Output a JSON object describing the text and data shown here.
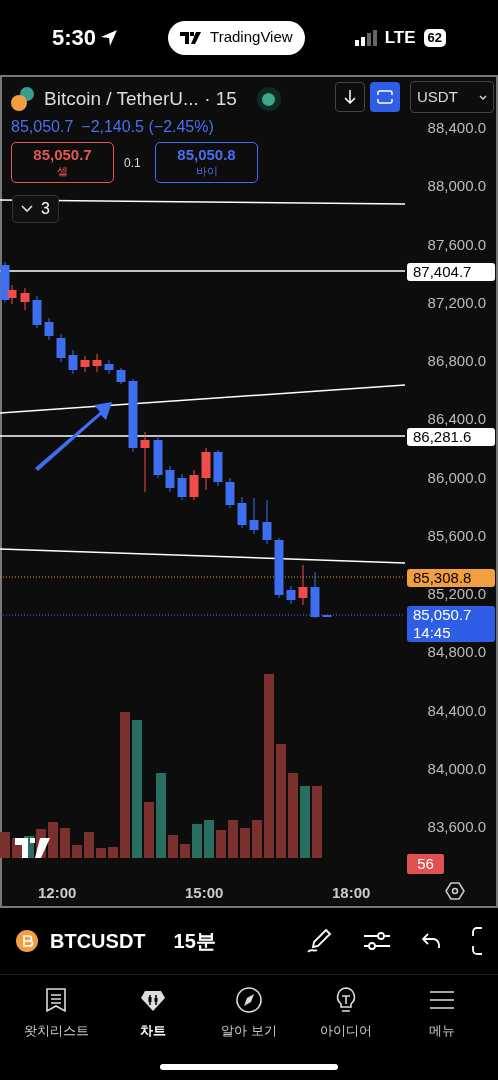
{
  "status_bar": {
    "time": "5:30",
    "app_pill": "TradingView",
    "network": "LTE",
    "battery": "62"
  },
  "chart": {
    "symbol": "Bitcoin / TetherU...",
    "interval": "· 15",
    "live": true,
    "currency": "USDT",
    "last_price": "85,050.7",
    "change": "−2,140.5 (−2.45%)",
    "sell": {
      "price": "85,050.7",
      "label": "셀"
    },
    "spread": "0.1",
    "buy": {
      "price": "85,050.8",
      "label": "바이"
    },
    "indicators_count": "3",
    "price_axis": [
      "88,400.0",
      "88,000.0",
      "87,600.0",
      "87,200.0",
      "86,800.0",
      "86,400.0",
      "86,000.0",
      "85,600.0",
      "85,200.0",
      "84,800.0",
      "84,400.0",
      "84,000.0",
      "83,600.0"
    ],
    "price_tags": [
      {
        "kind": "line",
        "text": "87,404.7"
      },
      {
        "kind": "line",
        "text": "86,281.6"
      },
      {
        "kind": "alert",
        "text": "85,308.8"
      },
      {
        "kind": "last",
        "text": "85,050.7",
        "countdown": "14:45"
      }
    ],
    "volume_tag": "56",
    "time_axis": [
      "12:00",
      "15:00",
      "18:00"
    ]
  },
  "toolbar": {
    "symbol": "BTCUSDT",
    "interval": "15분"
  },
  "nav": [
    {
      "label": "왓치리스트",
      "selected": false
    },
    {
      "label": "차트",
      "selected": true
    },
    {
      "label": "알아 보기",
      "selected": false
    },
    {
      "label": "아이디어",
      "selected": false
    },
    {
      "label": "메뉴",
      "selected": false
    }
  ]
}
